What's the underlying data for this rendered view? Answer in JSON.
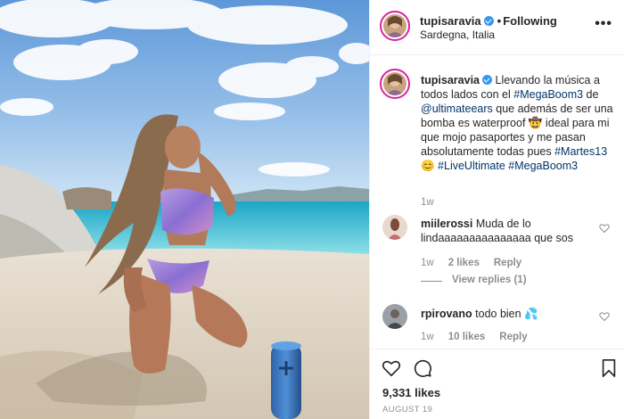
{
  "post": {
    "username": "tupisaravia",
    "follow_separator": "•",
    "follow_state": "Following",
    "location": "Sardegna, Italia",
    "more_label": "•••"
  },
  "caption": {
    "username": "tupisaravia",
    "text_1": " Llevando la música a todos lados con el ",
    "tag_1": "#MegaBoom3",
    "text_2": " de ",
    "tag_2": "@ultimateears",
    "text_3": " que además de ser una bomba es waterproof 🤠 ideal para mi que mojo pasaportes y me pasan absolutamente todas pues ",
    "tag_3": "#Martes13",
    "text_4": " 😊 ",
    "tag_4": "#LiveUltimate",
    "text_5": " ",
    "tag_5": "#MegaBoom3",
    "time": "1w"
  },
  "comments": [
    {
      "username": "miilerossi",
      "text": "Muda de lo lindaaaaaaaaaaaaaaa que sos",
      "time": "1w",
      "likes": "2 likes",
      "reply": "Reply",
      "view_replies": "View replies (1)"
    },
    {
      "username": "rpirovano",
      "text": "todo bien 💦",
      "time": "1w",
      "likes": "10 likes",
      "reply": "Reply"
    }
  ],
  "actions": {
    "likes": "9,331 likes",
    "date": "AUGUST 19"
  },
  "icons": {
    "verified": "verified-badge-icon",
    "like": "heart-icon",
    "comment": "comment-bubble-icon",
    "save": "bookmark-icon"
  },
  "colors": {
    "link": "#003569",
    "verified": "#3897f0",
    "muted": "#8e8e8e",
    "text": "#262626"
  }
}
